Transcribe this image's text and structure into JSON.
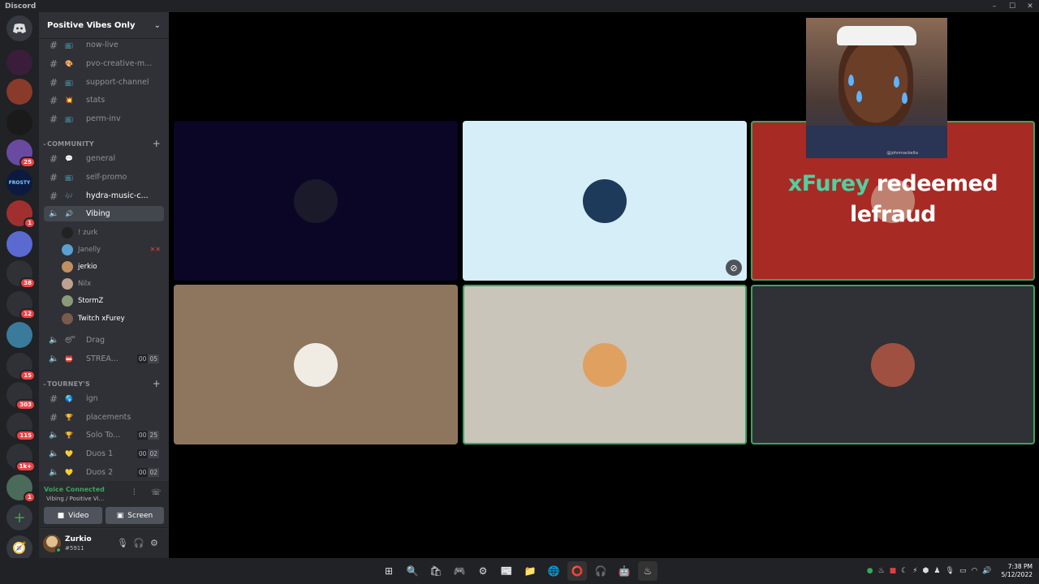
{
  "window": {
    "title": "Discord",
    "controls": [
      "–",
      "☐",
      "✕"
    ]
  },
  "server_rail": {
    "home_icon": "discord-logo-icon",
    "servers": [
      {
        "id": "s1",
        "color": "#3a1d3a",
        "badge": ""
      },
      {
        "id": "s2",
        "color": "#8a3a2a",
        "badge": ""
      },
      {
        "id": "s3",
        "color": "#1a1a1a",
        "badge": ""
      },
      {
        "id": "s4",
        "color": "#6a4aa0",
        "badge": "25"
      },
      {
        "id": "s5",
        "color": "#0c1a40",
        "badge": "",
        "label": "FROSTY"
      },
      {
        "id": "s6",
        "color": "#a03030",
        "badge": "1"
      },
      {
        "id": "s7",
        "color": "#5a6ad0",
        "badge": ""
      },
      {
        "id": "s8",
        "color": "#2f3136",
        "badge": "38"
      },
      {
        "id": "s9",
        "color": "#2f3136",
        "badge": "12"
      },
      {
        "id": "s10",
        "color": "#3a7a9a",
        "badge": ""
      },
      {
        "id": "s11",
        "color": "#2f3136",
        "badge": "15"
      },
      {
        "id": "s12",
        "color": "#2f3136",
        "badge": "303"
      },
      {
        "id": "s13",
        "color": "#2f3136",
        "badge": "115"
      },
      {
        "id": "s14",
        "color": "#2f3136",
        "badge": "1k+"
      },
      {
        "id": "s15",
        "color": "#4a6a5a",
        "badge": "1"
      }
    ],
    "add_server_icon": "plus-icon",
    "explore_icon": "compass-icon"
  },
  "guild": {
    "name": "Positive Vibes Only",
    "top_channels": [
      {
        "emoji": "📺",
        "name": "now-live"
      },
      {
        "emoji": "🎨",
        "name": "pvo-creative-m..."
      },
      {
        "emoji": "📺",
        "name": "support-channel"
      },
      {
        "emoji": "💥",
        "name": "stats"
      },
      {
        "emoji": "📺",
        "name": "perm-inv"
      }
    ],
    "community": {
      "label": "COMMUNITY",
      "channels": [
        {
          "emoji": "💬",
          "name": "general",
          "type": "text"
        },
        {
          "emoji": "📺",
          "name": "self-promo",
          "type": "text"
        },
        {
          "emoji": "🎶",
          "name": "hydra-music-c...",
          "type": "text",
          "bright": true
        }
      ],
      "voice_active": {
        "emoji": "🔊",
        "name": "Vibing"
      },
      "voice_users": [
        {
          "name": "! zurk",
          "lit": false,
          "color": "#222"
        },
        {
          "name": "Janelly",
          "lit": false,
          "color": "#5aa0d0",
          "muted": true
        },
        {
          "name": "jerkio",
          "lit": true,
          "color": "#c09060"
        },
        {
          "name": "Nilx",
          "lit": false,
          "color": "#c0a090"
        },
        {
          "name": "StormZ",
          "lit": true,
          "color": "#8a9a7a"
        },
        {
          "name": "Twitch xFurey",
          "lit": true,
          "color": "#7a5a4a"
        }
      ],
      "voice_others": [
        {
          "emoji": "😴",
          "name": "Drag",
          "counts": []
        },
        {
          "emoji": "📛",
          "name": "STREA...",
          "counts": [
            "00",
            "05"
          ]
        }
      ]
    },
    "tourney": {
      "label": "TOURNEY'S",
      "channels": [
        {
          "emoji": "🌎",
          "name": "ign",
          "type": "text",
          "counts": []
        },
        {
          "emoji": "🏆",
          "name": "placements",
          "type": "text",
          "counts": []
        },
        {
          "emoji": "🏆",
          "name": "Solo To...",
          "type": "voice",
          "counts": [
            "00",
            "25"
          ]
        },
        {
          "emoji": "💛",
          "name": "Duos 1",
          "type": "voice",
          "counts": [
            "00",
            "02"
          ]
        },
        {
          "emoji": "💛",
          "name": "Duos 2",
          "type": "voice",
          "counts": [
            "00",
            "02"
          ]
        }
      ]
    }
  },
  "voice_panel": {
    "status": "Voice Connected",
    "location": "Vibing / Positive Vi...",
    "video_label": "Video",
    "screen_label": "Screen"
  },
  "user_panel": {
    "username": "Zurkio",
    "tag": "#5911"
  },
  "stage": {
    "tiles": [
      {
        "id": "t1",
        "bg": "#0b0626",
        "avatar": "#1a1a2a",
        "speaking": false
      },
      {
        "id": "t2",
        "bg": "#d6eef8",
        "avatar": "#1e3a5a",
        "speaking": false,
        "no_share": true
      },
      {
        "id": "t3",
        "bg": "#a82a24",
        "avatar": "#c08070",
        "speaking": true
      },
      {
        "id": "t4",
        "bg": "#8e765e",
        "avatar": "#f0ece4",
        "speaking": false
      },
      {
        "id": "t5",
        "bg": "#c9c5bb",
        "avatar": "#e0a060",
        "speaking": true
      },
      {
        "id": "t6",
        "bg": "#2f3136",
        "avatar": "#a05040",
        "speaking": true
      }
    ],
    "overlay_watermark": "@johnmackelta",
    "redeem_name": "xFurey",
    "redeem_rest": " redeemed",
    "redeem_line2": "lefraud"
  },
  "taskbar": {
    "apps": [
      "⊞",
      "🔍",
      "🛍",
      "🎮",
      "⚙",
      "📰",
      "📁",
      "🌐",
      "⭕",
      "🎧",
      "🤖",
      "♨"
    ],
    "time": "7:38 PM",
    "date": "5/12/2022"
  }
}
